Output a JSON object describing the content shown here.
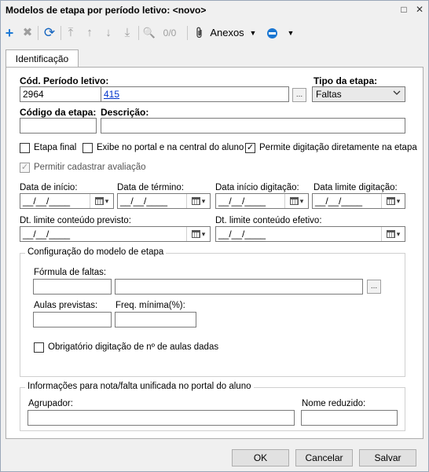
{
  "window": {
    "title": "Modelos de etapa por período letivo: <novo>",
    "controls": {
      "restore": "□",
      "close": "✕"
    }
  },
  "toolbar": {
    "add_icon": "+",
    "delete_icon": "✖",
    "refresh_icon": "⟳",
    "first_icon": "⤒",
    "prev_icon": "↑",
    "next_icon": "↓",
    "last_icon": "⤓",
    "search_icon": "🔍",
    "record_count": "0/0",
    "attachments_label": "Anexos",
    "dropdown_arrow": "▼",
    "more_arrow": "▼",
    "icon_colors": {
      "add": "#2e7d32",
      "refresh": "#1565c0",
      "disabled": "#9e9e9e"
    }
  },
  "tabs": [
    {
      "label": "Identificação"
    }
  ],
  "form": {
    "periodo_label": "Cód. Período letivo:",
    "periodo_code": "2964",
    "periodo_link": "415",
    "ellipsis": "...",
    "tipo_label": "Tipo da etapa:",
    "tipo_value": "Faltas",
    "select_arrow": "⌄",
    "codigo_label": "Código da etapa:",
    "codigo_value": "",
    "descricao_label": "Descrição:",
    "descricao_value": "",
    "checkboxes": {
      "etapa_final": {
        "label": "Etapa final",
        "checked": false
      },
      "exibe_portal": {
        "label": "Exibe no portal e na central do aluno",
        "checked": false
      },
      "permite_digitacao": {
        "label": "Permite digitação diretamente na etapa",
        "checked": true
      },
      "permitir_avaliacao": {
        "label": "Permitir cadastrar avaliação",
        "checked": true,
        "disabled": true
      }
    },
    "check_mark": "✓",
    "dates": {
      "inicio_label": "Data de início:",
      "termino_label": "Data de término:",
      "inicio_digitacao_label": "Data início digitação:",
      "limite_digitacao_label": "Data limite digitação:",
      "limite_previsto_label": "Dt. limite conteúdo previsto:",
      "limite_efetivo_label": "Dt. limite conteúdo efetivo:",
      "placeholder": "__/__/____",
      "cal_arrow": "▾"
    },
    "config_group": {
      "title": "Configuração do modelo de etapa",
      "formula_label": "Fórmula de faltas:",
      "formula_code": "",
      "formula_desc": "",
      "aulas_label": "Aulas previstas:",
      "aulas_value": "",
      "freq_label": "Freq. mínima(%):",
      "freq_value": "",
      "obrigatorio_label": "Obrigatório digitação de nº de aulas dadas",
      "obrigatorio_checked": false
    },
    "portal_group": {
      "title": "Informações para nota/falta unificada no portal do aluno",
      "agrupador_label": "Agrupador:",
      "agrupador_value": "",
      "nome_reduzido_label": "Nome reduzido:",
      "nome_reduzido_value": ""
    }
  },
  "buttons": {
    "ok": "OK",
    "cancel": "Cancelar",
    "save": "Salvar"
  }
}
